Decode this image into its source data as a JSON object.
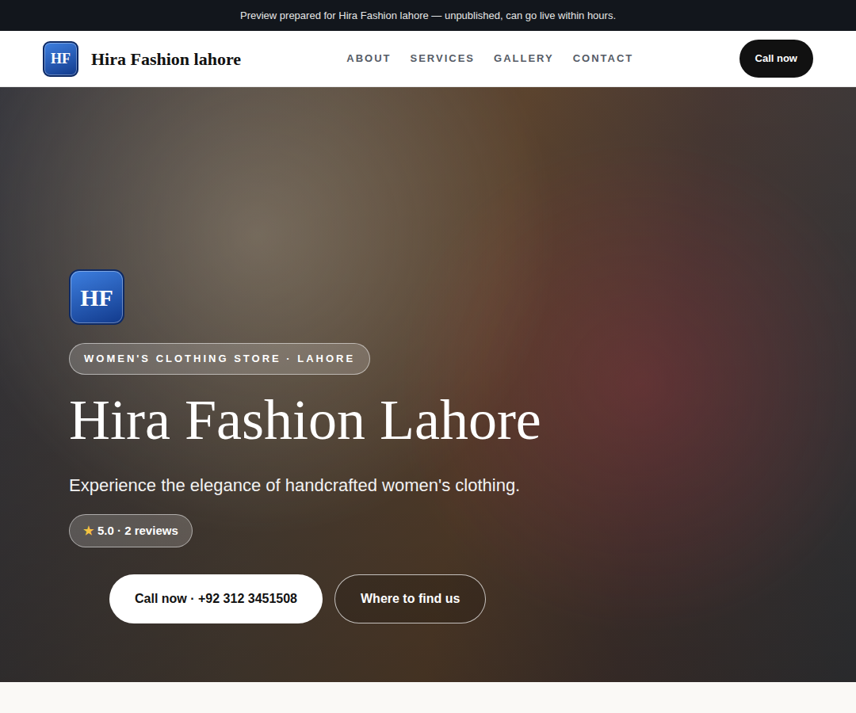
{
  "banner": "Preview prepared for Hira Fashion lahore — unpublished, can go live within hours.",
  "navbar": {
    "logo": "HF",
    "brand": "Hira Fashion lahore",
    "links": [
      "ABOUT",
      "SERVICES",
      "GALLERY",
      "CONTACT"
    ],
    "cta": "Call now"
  },
  "hero": {
    "logo": "HF",
    "tag": "WOMEN'S CLOTHING STORE · LAHORE",
    "title": "Hira Fashion Lahore",
    "subtitle": "Experience the elegance of handcrafted women's clothing.",
    "rating": {
      "star": "★",
      "text": "5.0 · 2 reviews"
    },
    "buttons": [
      "Call now · +92 312 3451508",
      "Where to find us"
    ]
  }
}
